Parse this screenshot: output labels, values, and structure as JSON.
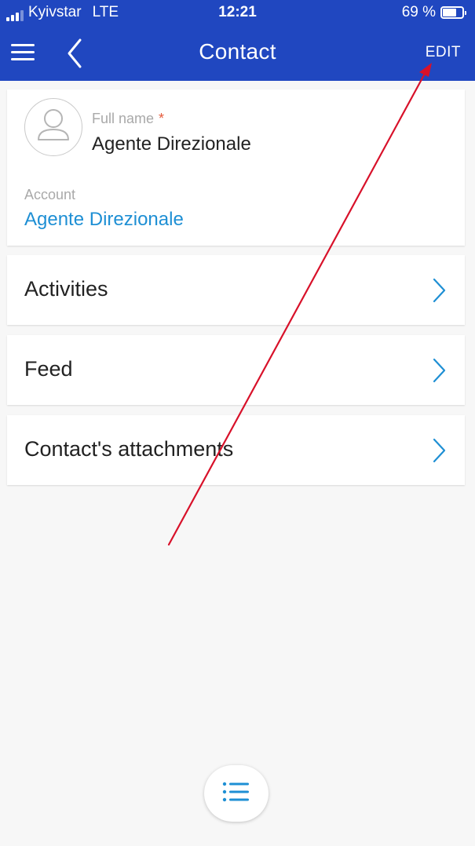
{
  "status_bar": {
    "carrier": "Kyivstar",
    "network": "LTE",
    "time": "12:21",
    "battery": "69 %",
    "battery_level": 0.69
  },
  "header": {
    "title": "Contact",
    "edit_label": "EDIT",
    "menu_icon": "hamburger-menu-icon",
    "back_icon": "chevron-left-icon"
  },
  "contact": {
    "full_name_label": "Full name",
    "required_mark": "*",
    "full_name": "Agente Direzionale",
    "account_label": "Account",
    "account": "Agente Direzionale"
  },
  "sections": [
    {
      "label": "Activities"
    },
    {
      "label": "Feed"
    },
    {
      "label": "Contact's attachments"
    }
  ],
  "fab": {
    "icon": "list-icon"
  },
  "colors": {
    "header_bg": "#2047c0",
    "accent": "#1e8fd4",
    "required": "#e55b3c",
    "annotation": "#d8112a"
  }
}
